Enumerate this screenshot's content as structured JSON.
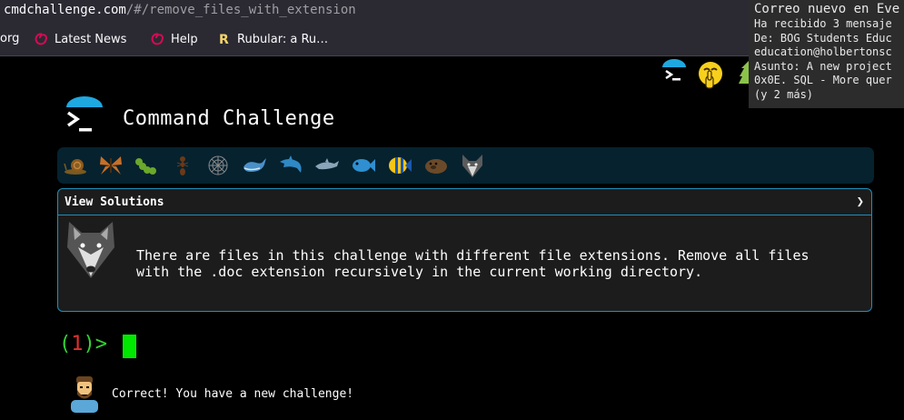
{
  "browser": {
    "url_host": "cmdchallenge.com",
    "url_path": "/#/remove_files_with_extension",
    "bookmarks": [
      {
        "label": "org",
        "icon": "none"
      },
      {
        "label": "Latest News",
        "icon": "debian-swirl-icon"
      },
      {
        "label": "Help",
        "icon": "debian-swirl-icon"
      },
      {
        "label": "Rubular: a Ru…",
        "icon": "rubular-r-icon"
      }
    ]
  },
  "notification": {
    "title": "Correo nuevo en Eve",
    "lines": [
      "Ha recibido 3 mensaje",
      "De: BOG Students Educ",
      "education@holbertonsc",
      "Asunto: A new project",
      "0x0E. SQL - More quer",
      "(y 2 más)"
    ]
  },
  "header": {
    "title": "Command Challenge"
  },
  "levels": [
    {
      "name": "snail"
    },
    {
      "name": "butterfly"
    },
    {
      "name": "caterpillar"
    },
    {
      "name": "ant"
    },
    {
      "name": "spider-web"
    },
    {
      "name": "whale"
    },
    {
      "name": "dolphin-blue"
    },
    {
      "name": "dolphin"
    },
    {
      "name": "fish"
    },
    {
      "name": "tropical-fish"
    },
    {
      "name": "seal"
    },
    {
      "name": "wolf"
    }
  ],
  "panel": {
    "view_solutions": "View Solutions",
    "toggle": "❯",
    "challenge": "There are files in this challenge with different file extensions. Remove all files\nwith the .doc extension recursively in the current working directory."
  },
  "prompt": {
    "open": "(",
    "number": "1",
    "close": ")>"
  },
  "feedback": {
    "message": "Correct! You have a new challenge!"
  },
  "colors": {
    "background": "#000000",
    "accent_blue": "#1f8fb8",
    "level_bar": "#06222f",
    "prompt_green": "#33d333",
    "prompt_red": "#e03030",
    "cursor": "#00e800"
  }
}
